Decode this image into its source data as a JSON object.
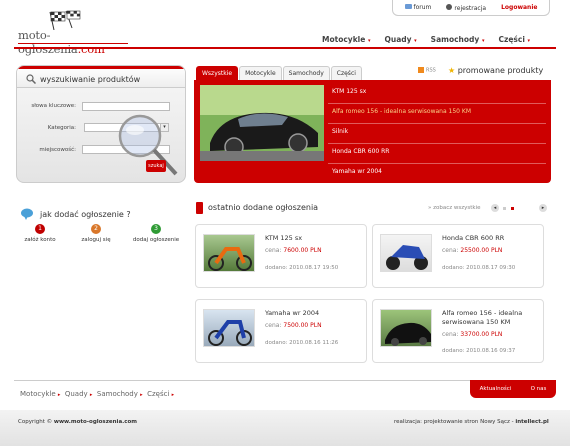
{
  "topbar": {
    "forum": "forum",
    "register": "rejestracja",
    "logout": "Logowanie"
  },
  "logo": {
    "text_main": "moto-ogloszenia",
    "text_domain": ".com"
  },
  "nav": [
    "Motocykle",
    "Quady",
    "Samochody",
    "Części"
  ],
  "search": {
    "title": "wyszukiwanie produktów",
    "keywords_label": "słowa kluczowe:",
    "category_label": "Kategoria:",
    "city_label": "miejscowość:",
    "button": "szukaj"
  },
  "how": {
    "title": "jak dodać ogłoszenie ?",
    "steps": [
      {
        "num": "1",
        "label": "załóż konto",
        "color": "#c00000"
      },
      {
        "num": "2",
        "label": "zaloguj się",
        "color": "#d9772a"
      },
      {
        "num": "3",
        "label": "dodaj ogłoszenie",
        "color": "#2f9b35"
      }
    ]
  },
  "promo": {
    "tabs": [
      "Wszystkie",
      "Motocykle",
      "Samochody",
      "Części"
    ],
    "rss": "RSS",
    "title": "promowane produkty",
    "items": [
      "KTM 125 sx",
      "Alfa romeo 156 - idealna serwisowana 150 KM",
      "Silnik",
      "Honda CBR 600 RR",
      "Yamaha wr 2004"
    ]
  },
  "recent": {
    "title": "ostatnio dodane ogłoszenia",
    "more": "» zobacz wszystkie",
    "price_label": "cena:",
    "added_label": "dodano:",
    "cards": [
      {
        "name": "KTM 125 sx",
        "price": "7600.00 PLN",
        "date": "2010.08.17 19:50"
      },
      {
        "name": "Honda CBR 600 RR",
        "price": "25500.00 PLN",
        "date": "2010.08.17 09:30"
      },
      {
        "name": "Yamaha wr 2004",
        "price": "7500.00 PLN",
        "date": "2010.08.16 11:26"
      },
      {
        "name": "Alfa romeo 156 - idealna serwisowana 150 KM",
        "price": "33700.00 PLN",
        "date": "2010.08.16 09:37"
      }
    ]
  },
  "footer": {
    "nav": [
      "Motocykle",
      "Quady",
      "Samochody",
      "Części"
    ],
    "tabs": [
      "Aktualności",
      "O nas"
    ],
    "copyright_prefix": "Copyright ©",
    "copyright_site": "www.moto-ogloszenia.com",
    "credit_prefix": "realizacja: projektowanie stron Nowy Sącz -",
    "credit_brand": "intellect.pl"
  },
  "colors": {
    "accent": "#cc0000"
  }
}
